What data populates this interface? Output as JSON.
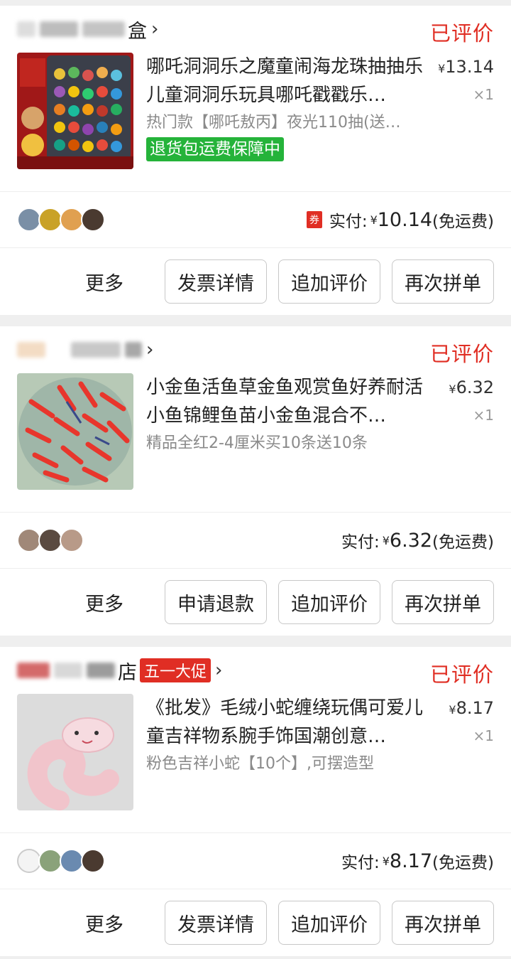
{
  "orders": [
    {
      "shop_suffix": "盒",
      "status": "已评价",
      "title": "哪吒洞洞乐之魔童闹海龙珠抽抽乐儿童洞洞乐玩具哪吒戳戳乐…",
      "spec": "热门款【哪吒敖丙】夜光110抽(送…",
      "guarantee": "退货包运费保障中",
      "unit_price": "13.14",
      "qty": "×1",
      "coupon": "券",
      "paid_label": "实付:",
      "paid_amount": "10.14",
      "paid_note": "(免运费)",
      "more": "更多",
      "buttons": [
        "发票详情",
        "追加评价",
        "再次拼单"
      ]
    },
    {
      "shop_suffix": "",
      "status": "已评价",
      "title": "小金鱼活鱼草金鱼观赏鱼好养耐活小鱼锦鲤鱼苗小金鱼混合不…",
      "spec": "精品全红2-4厘米买10条送10条",
      "unit_price": "6.32",
      "qty": "×1",
      "paid_label": "实付:",
      "paid_amount": "6.32",
      "paid_note": "(免运费)",
      "more": "更多",
      "buttons": [
        "申请退款",
        "追加评价",
        "再次拼单"
      ]
    },
    {
      "shop_suffix": "店",
      "promo": "五一大促",
      "status": "已评价",
      "title": "《批发》毛绒小蛇缠绕玩偶可爱儿童吉祥物系腕手饰国潮创意…",
      "spec": "粉色吉祥小蛇【10个】,可摆造型",
      "unit_price": "8.17",
      "qty": "×1",
      "paid_label": "实付:",
      "paid_amount": "8.17",
      "paid_note": "(免运费)",
      "more": "更多",
      "buttons": [
        "发票详情",
        "追加评价",
        "再次拼单"
      ]
    }
  ],
  "currency": "¥",
  "colors": {
    "accent_red": "#e02e24",
    "guarantee_green": "#25b33a"
  }
}
